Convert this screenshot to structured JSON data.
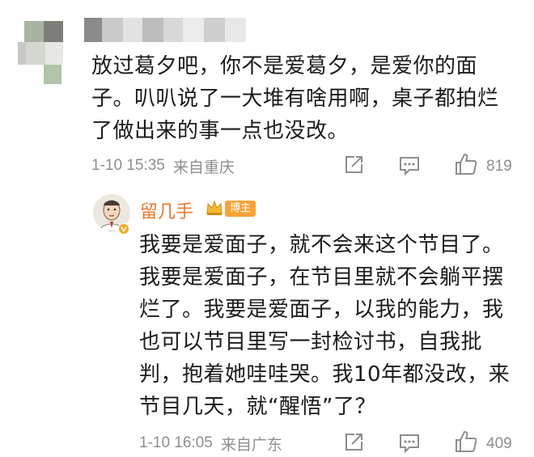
{
  "comment": {
    "text": "放过葛夕吧，你不是爱葛夕，是爱你的面子。叭叭说了一大堆有啥用啊，桌子都拍烂了做出来的事一点也没改。",
    "time": "1-10 15:35",
    "location": "来自重庆",
    "like_count": "819"
  },
  "reply": {
    "username": "留几手",
    "badge": "博主",
    "text": "我要是爱面子，就不会来这个节目了。我要是爱面子，在节目里就不会躺平摆烂了。我要是爱面子，以我的能力，我也可以节目里写一封检讨书，自我批判，抱着她哇哇哭。我10年都没改，来节目几天，就“醒悟”了？",
    "time": "1-10 16:05",
    "location": "来自广东",
    "like_count": "409"
  },
  "colors": {
    "text": "#1b1b1b",
    "meta": "#8e8e8e",
    "username": "#e8772e",
    "badge_bg": "#f6a43a"
  },
  "icons": [
    "share-icon",
    "comment-icon",
    "like-icon",
    "crown-icon",
    "verified-v-icon"
  ]
}
